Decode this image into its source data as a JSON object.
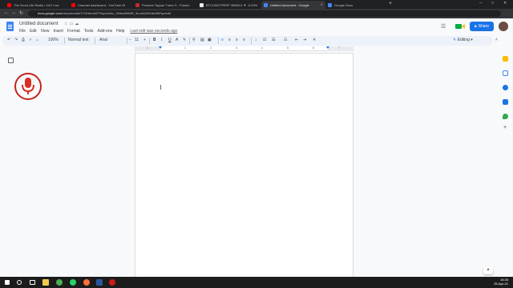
{
  "browser": {
    "tabs": [
      {
        "title": "The Good Life Radio • 24/7 Live",
        "favicon_color": "#ff0000"
      },
      {
        "title": "Channel dashboard - YouTube St",
        "favicon_color": "#ff0000"
      },
      {
        "title": "Porsche Taycan Turbo S - Porsch",
        "favicon_color": "#c62828"
      },
      {
        "title": "BTCUSDTPERP 39560.0 ▼ -0.29%",
        "favicon_color": "#e8eaed"
      },
      {
        "title": "Untitled document - Google",
        "favicon_color": "#4285f4"
      },
      {
        "title": "Google Docs",
        "favicon_color": "#4285f4"
      }
    ],
    "new_tab": "+",
    "url_host": "docs.google.com",
    "url_path": "/document/d/1TGHmni4Z79cp1w3cz_VNbw0tt6kR_3Lcv6Ut6Gdu3NPqc/edit"
  },
  "doc": {
    "title": "Untitled document",
    "menu": [
      "File",
      "Edit",
      "View",
      "Insert",
      "Format",
      "Tools",
      "Add-ons",
      "Help"
    ],
    "last_edit": "Last edit was seconds ago",
    "share_label": "Share"
  },
  "toolbar": {
    "zoom": "100%",
    "style": "Normal text",
    "font": "Arial",
    "size": "11",
    "bold": "B",
    "italic": "I",
    "underline": "U",
    "editing": "Editing"
  },
  "ruler": {
    "numbers": [
      "1",
      "1",
      "2",
      "3",
      "4",
      "5",
      "6",
      "7"
    ]
  },
  "taskbar": {
    "time": "16:28",
    "date": "25-Apr-21"
  }
}
